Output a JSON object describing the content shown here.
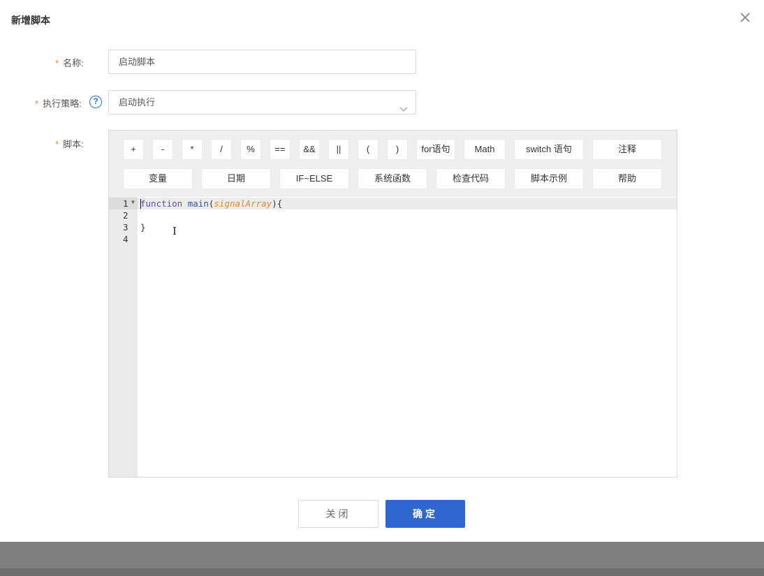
{
  "dialog": {
    "title": "新增脚本",
    "close_icon": "close-icon"
  },
  "form": {
    "name_label": "名称:",
    "name_value": "启动脚本",
    "strategy_label": "执行策略:",
    "strategy_value": "启动执行",
    "help_icon": "?",
    "script_label": "脚本:",
    "required_mark": "*"
  },
  "toolbar": {
    "row1": [
      "+",
      "-",
      "*",
      "/",
      "%",
      "==",
      "&&",
      "||",
      "(",
      ")",
      "for语句",
      "Math",
      "switch 语句",
      "注释"
    ],
    "row2": [
      "变量",
      "日期",
      "IF~ELSE",
      "系统函数",
      "检查代码",
      "脚本示例",
      "帮助"
    ]
  },
  "editor": {
    "line_numbers": [
      "1",
      "2",
      "3",
      "4"
    ],
    "code": {
      "kw": "function",
      "fn": "main",
      "open": "(",
      "param": "signalArray",
      "close": "){",
      "line3": "}"
    }
  },
  "footer": {
    "close_label": "关闭",
    "confirm_label": "确定"
  },
  "colors": {
    "accent": "#2f66cf",
    "required": "#f0883a",
    "help": "#2f74d0"
  }
}
